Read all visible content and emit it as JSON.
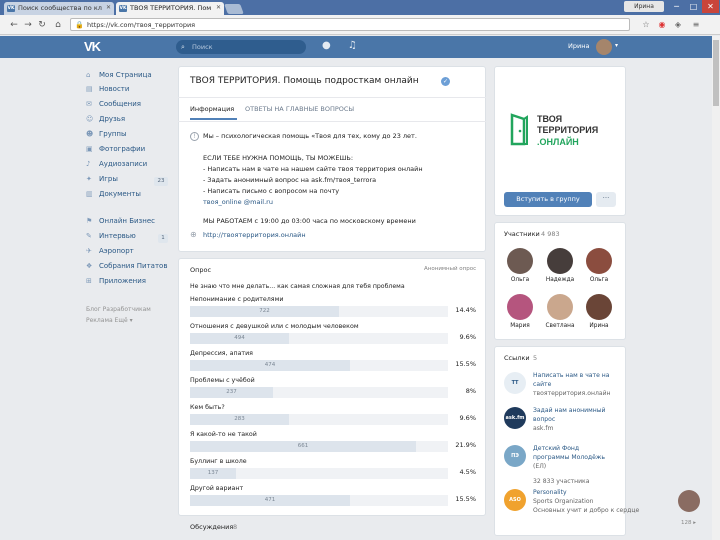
{
  "browser": {
    "tabs": [
      {
        "title": "Поиск сообщества по кл"
      },
      {
        "title": "ТВОЯ ТЕРРИТОРИЯ. Пом"
      }
    ],
    "user_chip": "Ирина",
    "url": "https://vk.com/твоя_территория",
    "controls": {
      "minimize": "─",
      "maximize": "□",
      "close": "✕"
    }
  },
  "vk_header": {
    "logo": "VK",
    "search_placeholder": "Поиск",
    "user_name": "Ирина"
  },
  "left_menu": {
    "items": [
      {
        "label": "Моя Страница",
        "icon": "home-icon"
      },
      {
        "label": "Новости",
        "icon": "news-icon"
      },
      {
        "label": "Сообщения",
        "icon": "messages-icon"
      },
      {
        "label": "Друзья",
        "icon": "friends-icon"
      },
      {
        "label": "Группы",
        "icon": "groups-icon"
      },
      {
        "label": "Фотографии",
        "icon": "photos-icon"
      },
      {
        "label": "Аудиозаписи",
        "icon": "audio-icon"
      },
      {
        "label": "Игры",
        "icon": "games-icon",
        "badge": "23"
      },
      {
        "label": "Документы",
        "icon": "documents-icon"
      },
      {
        "label": "Онлайн Бизнес",
        "icon": "business-icon"
      },
      {
        "label": "Интервью",
        "icon": "interview-icon",
        "badge": "1"
      },
      {
        "label": "Аэропорт",
        "icon": "airport-icon"
      },
      {
        "label": "Собрания Питатов",
        "icon": "collection-icon"
      },
      {
        "label": "Приложения",
        "icon": "apps-icon"
      }
    ],
    "footer_line1": "Блог  Разработчикам",
    "footer_line2": "Реклама  Ещё ▾"
  },
  "community": {
    "title": "ТВОЯ ТЕРРИТОРИЯ. Помощь подросткам онлайн",
    "tabs": [
      "Информация",
      "ОТВЕТЫ НА ГЛАВНЫЕ ВОПРОСЫ"
    ],
    "description": [
      "Мы – психологическая помощь «Твоя для тех, кому до 23 лет.",
      "",
      "ЕСЛИ ТЕБЕ НУЖНА ПОМОЩЬ, ТЫ МОЖЕШЬ:",
      "- Написать нам в чате на нашем сайте твоя территория онлайн",
      "- Задать анонимный вопрос на ask.fm/твоя_terrora",
      "- Написать письмо с вопросом на почту",
      "твоя_online @mail.ru",
      "",
      "МЫ РАБОТАЕМ с 19:00 до 03:00 часа по московскому времени"
    ],
    "site": "http://твоятерритория.онлайн"
  },
  "poll": {
    "label": "Опрос",
    "type": "Анонимный опрос",
    "question": "Не знаю что мне делать... как самая сложная для тебя проблема",
    "options": [
      {
        "label": "Непонимание с родителями",
        "count": "722",
        "pct": "14.4%",
        "value": 14.4
      },
      {
        "label": "Отношения с девушкой или с молодым человеком",
        "count": "494",
        "pct": "9.6%",
        "value": 9.6
      },
      {
        "label": "Депрессия, апатия",
        "count": "474",
        "pct": "15.5%",
        "value": 15.5
      },
      {
        "label": "Проблемы с учёбой",
        "count": "237",
        "pct": "8%",
        "value": 8
      },
      {
        "label": "Кем быть?",
        "count": "283",
        "pct": "9.6%",
        "value": 9.6
      },
      {
        "label": "Я какой-то не такой",
        "count": "661",
        "pct": "21.9%",
        "value": 21.9
      },
      {
        "label": "Буллинг в школе",
        "count": "137",
        "pct": "4.5%",
        "value": 4.5
      },
      {
        "label": "Другой вариант",
        "count": "471",
        "pct": "15.5%",
        "value": 15.5
      }
    ]
  },
  "discussions": {
    "label": "Обсуждения",
    "count": "8"
  },
  "logo": {
    "line1": "ТВОЯ",
    "line2": "ТЕРРИТОРИЯ",
    "line3": ".ОНЛАЙН",
    "green": "#22a55d"
  },
  "join_button": "Вступить в группу",
  "more_button": "···",
  "members": {
    "label": "Участники",
    "count": "4 983",
    "people": [
      {
        "name": "Ольга",
        "color": "#6d5a52"
      },
      {
        "name": "Надежда",
        "color": "#463d3b"
      },
      {
        "name": "Ольга",
        "color": "#8b4d3f"
      },
      {
        "name": "Мария",
        "color": "#b5557e"
      },
      {
        "name": "Светлана",
        "color": "#caa78d"
      },
      {
        "name": "Ирина",
        "color": "#6a4537"
      }
    ]
  },
  "contacts": {
    "label": "Ссылки",
    "count": "5",
    "items": [
      {
        "logo": "ТТ",
        "color": "#e7eef4",
        "line1": "Написать нам в чате на",
        "line2": "сайте",
        "line3": "твоятерритория.онлайн"
      },
      {
        "logo": "ask.fm",
        "color": "#1f3a5c",
        "line1": "Задай нам анонимный",
        "line2": "вопрос",
        "line3": "ask.fm"
      },
      {
        "logo": "ПЭ",
        "color": "#7aa7c7",
        "line1": "Детский Фонд",
        "line2": "программы Молодёжь",
        "line3": "(ЕЛ)"
      },
      {
        "logo": "",
        "color": "",
        "line1": "32 833 участника",
        "line2": "",
        "line3": ""
      },
      {
        "logo": "ASO",
        "color": "#f0a22e",
        "line1": "Personality",
        "line2": "Sports Organization",
        "line3": "Основных учит и добро к сердце"
      }
    ]
  },
  "chat_count": "128 ▸"
}
